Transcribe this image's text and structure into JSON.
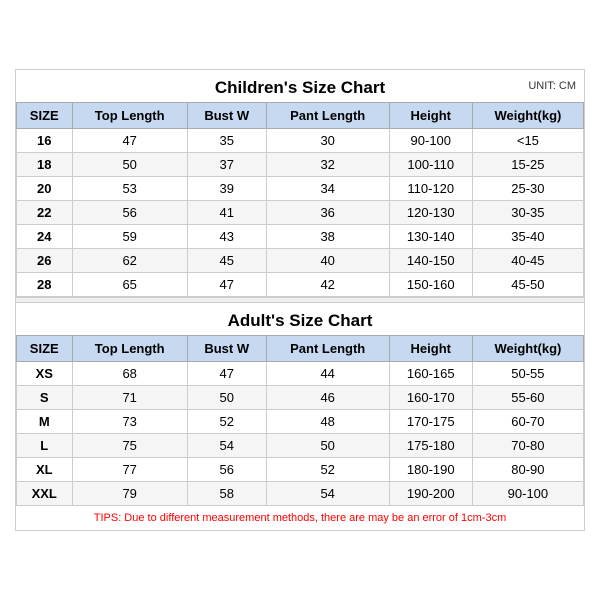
{
  "children_title": "Children's Size Chart",
  "adult_title": "Adult's Size Chart",
  "unit_label": "UNIT: CM",
  "columns": [
    "SIZE",
    "Top Length",
    "Bust W",
    "Pant Length",
    "Height",
    "Weight(kg)"
  ],
  "children_rows": [
    [
      "16",
      "47",
      "35",
      "30",
      "90-100",
      "<15"
    ],
    [
      "18",
      "50",
      "37",
      "32",
      "100-110",
      "15-25"
    ],
    [
      "20",
      "53",
      "39",
      "34",
      "110-120",
      "25-30"
    ],
    [
      "22",
      "56",
      "41",
      "36",
      "120-130",
      "30-35"
    ],
    [
      "24",
      "59",
      "43",
      "38",
      "130-140",
      "35-40"
    ],
    [
      "26",
      "62",
      "45",
      "40",
      "140-150",
      "40-45"
    ],
    [
      "28",
      "65",
      "47",
      "42",
      "150-160",
      "45-50"
    ]
  ],
  "adult_rows": [
    [
      "XS",
      "68",
      "47",
      "44",
      "160-165",
      "50-55"
    ],
    [
      "S",
      "71",
      "50",
      "46",
      "160-170",
      "55-60"
    ],
    [
      "M",
      "73",
      "52",
      "48",
      "170-175",
      "60-70"
    ],
    [
      "L",
      "75",
      "54",
      "50",
      "175-180",
      "70-80"
    ],
    [
      "XL",
      "77",
      "56",
      "52",
      "180-190",
      "80-90"
    ],
    [
      "XXL",
      "79",
      "58",
      "54",
      "190-200",
      "90-100"
    ]
  ],
  "tips": "TIPS: Due to different measurement methods, there are may be an error of 1cm-3cm"
}
